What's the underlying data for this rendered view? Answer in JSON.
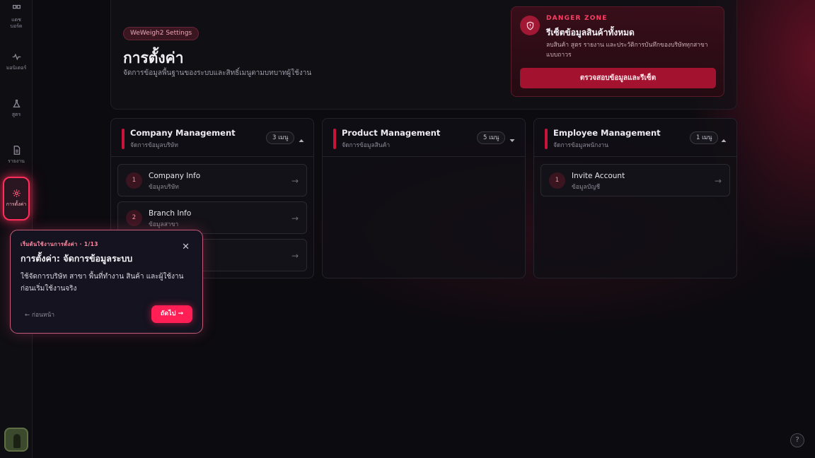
{
  "sidebar": {
    "items": [
      {
        "label": "แดช\nบอร์ด",
        "icon": "dashboard-icon"
      },
      {
        "label": "มอนิเตอร์",
        "icon": "monitor-icon"
      },
      {
        "label": "สูตร",
        "icon": "flask-icon"
      },
      {
        "label": "รายงาน",
        "icon": "report-icon"
      },
      {
        "label": "การตั้งค่า",
        "icon": "gear-icon",
        "active": true
      }
    ],
    "avatar_icon": "user-avatar"
  },
  "header": {
    "badge": "WeWeigh2 Settings",
    "title": "การตั้งค่า",
    "subtitle": "จัดการข้อมูลพื้นฐานของระบบและสิทธิ์เมนูตามบทบาทผู้ใช้งาน"
  },
  "danger_zone": {
    "tag": "DANGER ZONE",
    "title": "รีเซ็ตข้อมูลสินค้าทั้งหมด",
    "description": "ลบสินค้า สูตร รายงาน และประวัติการบันทึกของบริษัททุกสาขาแบบถาวร",
    "button_label": "ตรวจสอบข้อมูลและรีเซ็ต",
    "accent_color": "#ff3d63"
  },
  "cards": [
    {
      "title": "Company Management",
      "subtitle": "จัดการข้อมูลบริษัท",
      "count": "3 เมนู",
      "expanded": true,
      "rows": [
        {
          "num": "1",
          "title": "Company Info",
          "subtitle": "ข้อมูลบริษัท"
        },
        {
          "num": "2",
          "title": "Branch Info",
          "subtitle": "ข้อมูลสาขา"
        }
      ]
    },
    {
      "title": "Product Management",
      "subtitle": "จัดการข้อมูลสินค้า",
      "count": "5 เมนู",
      "expanded": false,
      "rows": []
    },
    {
      "title": "Employee Management",
      "subtitle": "จัดการข้อมูลพนักงาน",
      "count": "1 เมนู",
      "expanded": true,
      "rows": [
        {
          "num": "1",
          "title": "Invite Account",
          "subtitle": "ข้อมูลบัญชี"
        }
      ]
    }
  ],
  "tour": {
    "step": "เริ่มต้นใช้งานการตั้งค่า · 1/13",
    "title": "การตั้งค่า: จัดการข้อมูลระบบ",
    "body": "ใช้จัดการบริษัท สาขา พื้นที่ทำงาน สินค้า และผู้ใช้งาน ก่อนเริ่มใช้งานจริง",
    "prev_label": "ก่อนหน้า",
    "next_label": "ถัดไป",
    "close_icon": "close-icon"
  },
  "help_icon": "help-icon",
  "colors": {
    "accent": "#ff1f55",
    "background": "#0c0b10",
    "danger": "#a3122f"
  }
}
